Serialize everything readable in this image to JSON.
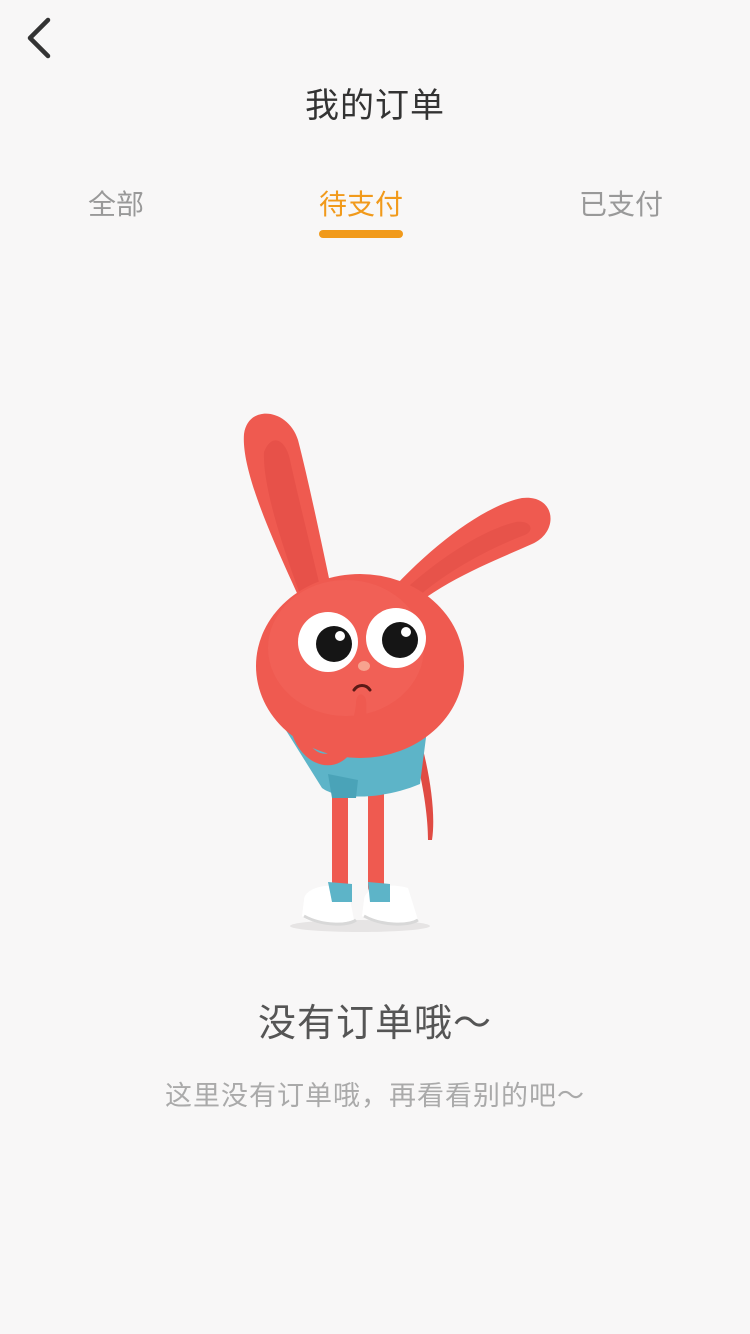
{
  "header": {
    "back_icon": "chevron-left-icon",
    "title": "我的订单"
  },
  "tabs": [
    {
      "label": "全部",
      "active": false
    },
    {
      "label": "待支付",
      "active": true
    },
    {
      "label": "已支付",
      "active": false
    }
  ],
  "colors": {
    "accent": "#f19a1b",
    "background": "#f8f7f7",
    "mascot_red": "#ef5a50",
    "mascot_blue": "#5db4c8"
  },
  "empty_state": {
    "illustration": "red-rabbit-mascot",
    "title": "没有订单哦～",
    "subtitle": "这里没有订单哦，再看看别的吧～"
  }
}
